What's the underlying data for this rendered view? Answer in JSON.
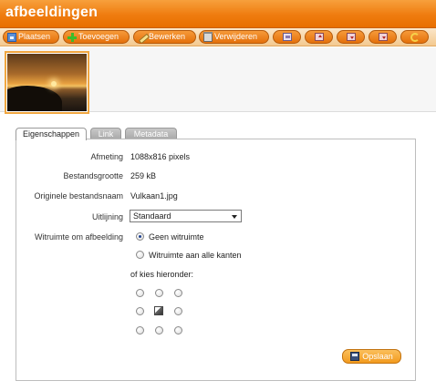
{
  "header": {
    "title": "afbeeldingen",
    "accent": "#ef7c0f"
  },
  "toolbar": {
    "buttons": [
      {
        "label": "Plaatsen",
        "icon": "place-image-icon"
      },
      {
        "label": "Toevoegen",
        "icon": "add-icon"
      },
      {
        "label": "Bewerken",
        "icon": "pencil-icon"
      },
      {
        "label": "Verwijderen",
        "icon": "trash-icon"
      },
      {
        "label": "",
        "icon": "image-center-icon"
      },
      {
        "label": "",
        "icon": "move-up-icon"
      },
      {
        "label": "",
        "icon": "move-down-icon"
      },
      {
        "label": "",
        "icon": "move-to-bottom-icon"
      },
      {
        "label": "",
        "icon": "undo-icon"
      }
    ]
  },
  "thumbnail": {
    "alt": "Vulkaan1.jpg",
    "selected": true
  },
  "tabs": [
    {
      "label": "Eigenschappen",
      "active": true
    },
    {
      "label": "Link",
      "active": false
    },
    {
      "label": "Metadata",
      "active": false
    }
  ],
  "properties": {
    "size_label": "Afmeting",
    "size_value": "1088x816 pixels",
    "filesize_label": "Bestandsgrootte",
    "filesize_value": "259 kB",
    "filename_label": "Originele bestandsnaam",
    "filename_value": "Vulkaan1.jpg",
    "align_label": "Uitlijning",
    "align_value": "Standaard",
    "spacing_label": "Witruimte om afbeelding",
    "spacing_options": [
      "Geen witruimte",
      "Witruimte aan alle kanten"
    ],
    "spacing_selected": "Geen witruimte",
    "choose_label": "of kies hieronder:",
    "position_selected": "center"
  },
  "actions": {
    "save_label": "Opslaan"
  }
}
